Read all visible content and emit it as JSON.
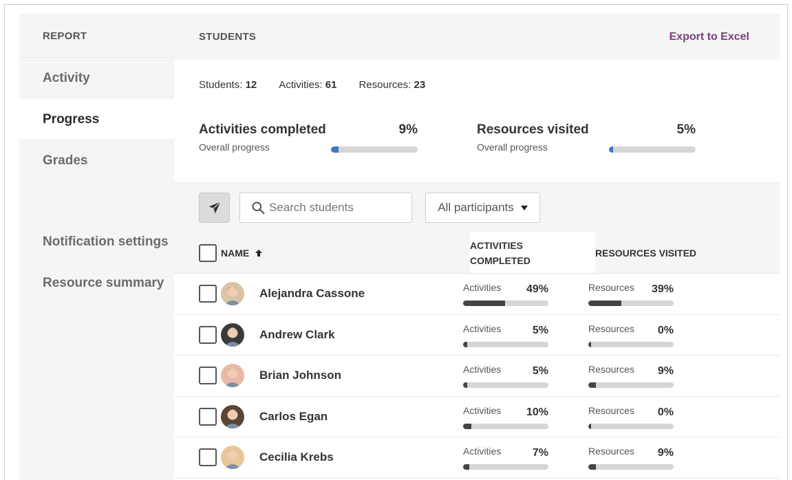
{
  "sidebar": {
    "header": "REPORT",
    "items": [
      {
        "label": "Activity",
        "active": false
      },
      {
        "label": "Progress",
        "active": true
      },
      {
        "label": "Grades",
        "active": false
      }
    ],
    "secondary_items": [
      {
        "label": "Notification settings"
      },
      {
        "label": "Resource summary"
      }
    ]
  },
  "main": {
    "title": "STUDENTS",
    "export_label": "Export to Excel",
    "counts": {
      "students_label": "Students:",
      "students": "12",
      "activities_label": "Activities:",
      "activities": "61",
      "resources_label": "Resources:",
      "resources": "23"
    },
    "activities_progress": {
      "title": "Activities completed",
      "percent_text": "9%",
      "sub": "Overall progress",
      "value": 9
    },
    "resources_progress": {
      "title": "Resources visited",
      "percent_text": "5%",
      "sub": "Overall progress",
      "value": 5
    },
    "toolbar": {
      "send_icon": "paper-plane-icon",
      "search_placeholder": "Search students",
      "filter_selected": "All participants"
    },
    "table": {
      "col_name": "NAME",
      "col_activities": "ACTIVITIES COMPLETED",
      "col_resources": "RESOURCES VISITED",
      "metric_activities_label": "Activities",
      "metric_resources_label": "Resources",
      "rows": [
        {
          "name": "Alejandra Cassone",
          "activities_text": "49%",
          "activities": 49,
          "resources_text": "39%",
          "resources": 39,
          "avatar_bg": "#d8c3a5",
          "avatar_hair": "#6b4a2b"
        },
        {
          "name": "Andrew Clark",
          "activities_text": "5%",
          "activities": 5,
          "resources_text": "0%",
          "resources": 0,
          "avatar_bg": "#3a3a3a",
          "avatar_hair": "#1e1e1e"
        },
        {
          "name": "Brian Johnson",
          "activities_text": "5%",
          "activities": 5,
          "resources_text": "9%",
          "resources": 9,
          "avatar_bg": "#e9b8a8",
          "avatar_hair": "#c9956d"
        },
        {
          "name": "Carlos Egan",
          "activities_text": "10%",
          "activities": 10,
          "resources_text": "0%",
          "resources": 0,
          "avatar_bg": "#5a4636",
          "avatar_hair": "#2a1e16"
        },
        {
          "name": "Cecilia Krebs",
          "activities_text": "7%",
          "activities": 7,
          "resources_text": "9%",
          "resources": 9,
          "avatar_bg": "#e5c79a",
          "avatar_hair": "#c9a36a"
        }
      ]
    }
  },
  "colors": {
    "accent_link": "#7a3e7c",
    "overall_bar": "#3a78c5",
    "row_bar": "#444444"
  }
}
